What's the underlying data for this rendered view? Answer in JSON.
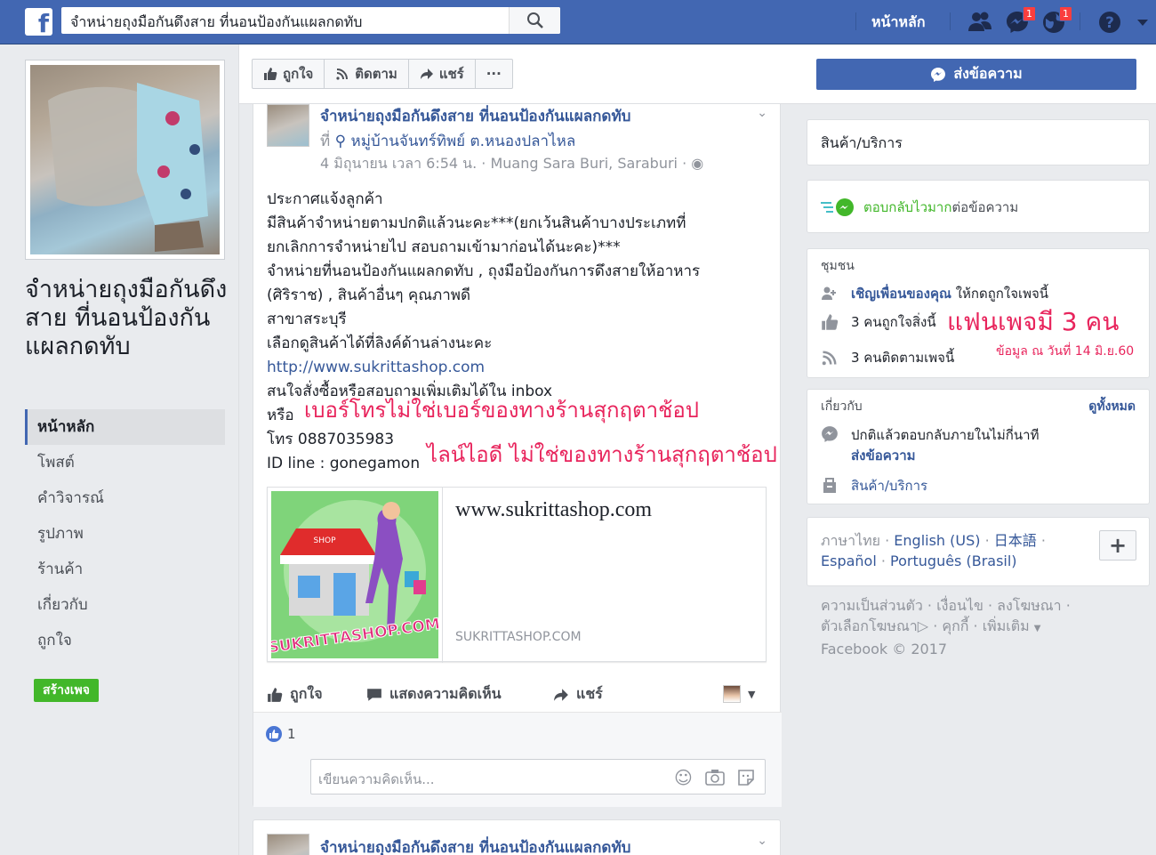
{
  "topbar": {
    "logo": "f",
    "search_value": "จำหน่ายถุงมือกันดึงสาย ที่นอนป้องกันแผลกดทับ",
    "home": "หน้าหลัก",
    "friend_requests_badge": "",
    "messages_badge": "1",
    "notifications_badge": "1",
    "accent": "#4267b2"
  },
  "left": {
    "page_name": "จำหน่ายถุงมือกันดึงสาย ที่นอนป้องกันแผลกดทับ",
    "nav": [
      "หน้าหลัก",
      "โพสต์",
      "คำวิจารณ์",
      "รูปภาพ",
      "ร้านค้า",
      "เกี่ยวกับ",
      "ถูกใจ"
    ],
    "create_page": "สร้างเพจ"
  },
  "action_bar": {
    "like": "ถูกใจ",
    "follow": "ติดตาม",
    "share": "แชร์",
    "more": "···",
    "send_message": "ส่งข้อความ"
  },
  "post": {
    "title": "จำหน่ายถุงมือกันดึงสาย ที่นอนป้องกันแผลกดทับ",
    "at": "ที่",
    "location": "หมู่บ้านจันทร์ทิพย์ ต.หนองปลาไหล",
    "time": "4 มิถุนายน เวลา 6:54 น. · Muang Sara Buri, Saraburi ·",
    "lines": [
      "ประกาศแจ้งลูกค้า",
      "มีสินค้าจำหน่ายตามปกติแล้วนะคะ***(ยกเว้นสินค้าบางประเภทที่",
      "ยกเลิกการจำหน่ายไป สอบถามเข้ามาก่อนได้นะคะ)***",
      "จำหน่ายที่นอนป้องกันแผลกดทับ , ถุงมือป้องกันการดึงสายให้อาหาร",
      "(ศิริราช) , สินค้าอื่นๆ คุณภาพดี",
      "สาขาสระบุรี",
      "เลือกดูสินค้าได้ที่ลิงค์ด้านล่างนะคะ"
    ],
    "link": "http://www.sukrittashop.com",
    "line_inbox": "สนใจสั่งซื้อหรือสอบถามเพิ่มเติมได้ใน inbox",
    "or": "หรือ",
    "phone_note": "เบอร์โทรไม่ใช่เบอร์ของทางร้านสุกฤตาช้อป",
    "phone": "โทร 0887035983",
    "line_id": "ID line : gonegamon",
    "line_note": "ไลน์ไอดี ไม่ใช่ของทางร้านสุกฤตาช้อป",
    "card_title": "www.sukrittashop.com",
    "card_domain": "SUKRITTASHOP.COM",
    "card_logo_text": "SUKRITTASHOP.COM",
    "card_shop_sign": "SHOP",
    "actions": {
      "like": "ถูกใจ",
      "comment": "แสดงความคิดเห็น",
      "share": "แชร์"
    },
    "like_count": "1",
    "comment_placeholder": "เขียนความคิดเห็น..."
  },
  "post2": {
    "title": "จำหน่ายถุงมือกันดึงสาย ที่นอนป้องกันแผลกดทับ"
  },
  "right": {
    "products": "สินค้า/บริการ",
    "responsive_fast": "ตอบกลับไวมาก",
    "responsive_rest": "ต่อข้อความ",
    "community_head": "ชุมชน",
    "invite_link": "เชิญเพื่อนของคุณ",
    "invite_rest": "ให้กดถูกใจเพจนี้",
    "likes": "3 คนถูกใจสิ่งนี้",
    "fans_note": "แฟนเพจมี 3 คน",
    "follows": "3 คนติดตามเพจนี้",
    "date_note": "ข้อมูล ณ วันที่ 14 มิ.ย.60",
    "about_head": "เกี่ยวกับ",
    "see_all": "ดูทั้งหมด",
    "reply_time": "ปกติแล้วตอบกลับภายในไม่กี่นาที",
    "send_message": "ส่งข้อความ",
    "products2": "สินค้า/บริการ",
    "languages": [
      "ภาษาไทย",
      "English (US)",
      "日本語",
      "Español",
      "Português (Brasil)"
    ],
    "add": "+",
    "footer1": "ความเป็นส่วนตัว · เงื่อนไข · ลงโฆษณา ·",
    "footer2a": "ตัวเลือกโฆษณา",
    "footer2b": "· คุกกี้ · เพิ่มเติม",
    "footer3": "Facebook © 2017"
  }
}
